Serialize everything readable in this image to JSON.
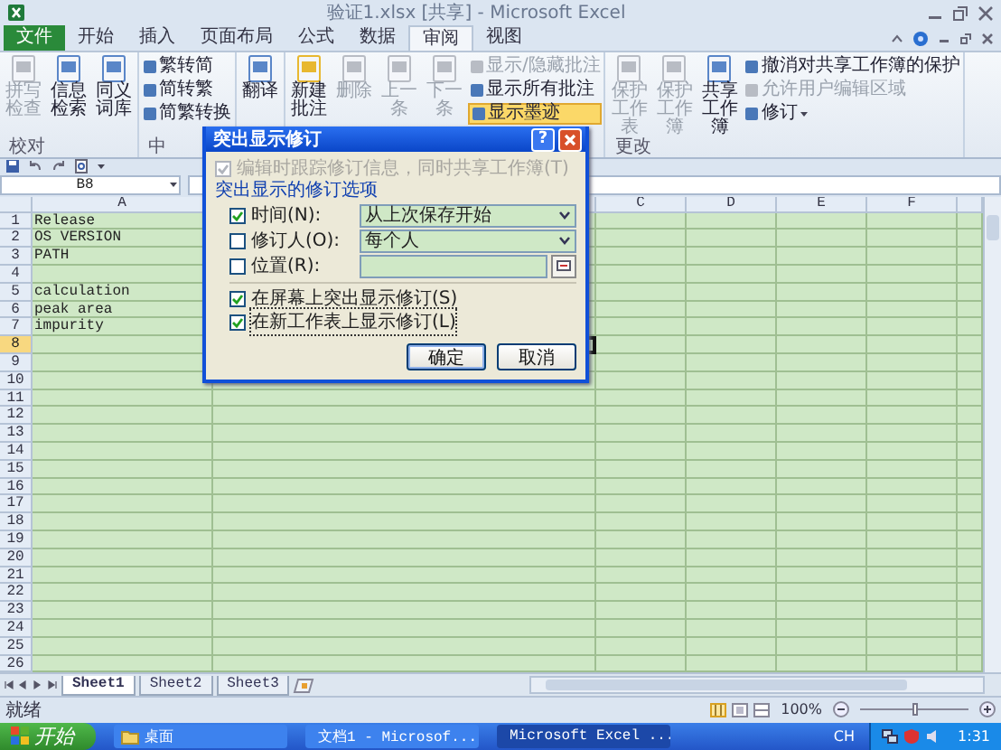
{
  "window": {
    "title": "验证1.xlsx [共享] - Microsoft Excel"
  },
  "tabs": [
    {
      "label": "文件",
      "kind": "file",
      "selected": false
    },
    {
      "label": "开始",
      "kind": "tab",
      "selected": false
    },
    {
      "label": "插入",
      "kind": "tab",
      "selected": false
    },
    {
      "label": "页面布局",
      "kind": "tab",
      "selected": false
    },
    {
      "label": "公式",
      "kind": "tab",
      "selected": false
    },
    {
      "label": "数据",
      "kind": "tab",
      "selected": false
    },
    {
      "label": "审阅",
      "kind": "tab",
      "selected": true
    },
    {
      "label": "视图",
      "kind": "tab",
      "selected": false
    }
  ],
  "ribbon": {
    "groups": [
      {
        "label": "校对",
        "items": [
          {
            "label": "拼写检查",
            "kind": "large",
            "disabled": true
          },
          {
            "label": "信息检索",
            "kind": "large",
            "disabled": false
          },
          {
            "label": "同义词库",
            "kind": "large",
            "disabled": false
          }
        ]
      },
      {
        "label": "中",
        "items": [
          {
            "label": "繁转简",
            "kind": "small",
            "disabled": false,
            "on": false
          },
          {
            "label": "简转繁",
            "kind": "small",
            "disabled": false,
            "on": false
          },
          {
            "label": "简繁转换",
            "kind": "small",
            "disabled": false,
            "on": false
          }
        ]
      },
      {
        "items": [
          {
            "label": "翻译",
            "kind": "large",
            "disabled": false
          }
        ]
      },
      {
        "items": [
          {
            "label": "新建批注",
            "kind": "large",
            "disabled": false
          },
          {
            "label": "删除",
            "kind": "large",
            "disabled": true
          },
          {
            "label": "上一条",
            "kind": "large",
            "disabled": true
          },
          {
            "label": "下一条",
            "kind": "large",
            "disabled": true
          },
          {
            "label": "显示/隐藏批注",
            "kind": "small",
            "disabled": true,
            "on": false
          },
          {
            "label": "显示所有批注",
            "kind": "small",
            "disabled": false,
            "on": false
          },
          {
            "label": "显示墨迹",
            "kind": "small",
            "disabled": false,
            "on": true
          }
        ]
      },
      {
        "label": "更改",
        "items": [
          {
            "label": "保护工作表",
            "kind": "large",
            "disabled": true
          },
          {
            "label": "保护工作簿",
            "kind": "large",
            "disabled": true
          },
          {
            "label": "共享工作簿",
            "kind": "large",
            "disabled": false
          },
          {
            "label": "撤消对共享工作簿的保护",
            "kind": "small",
            "disabled": false,
            "on": false
          },
          {
            "label": "允许用户编辑区域",
            "kind": "small",
            "disabled": true,
            "on": false
          },
          {
            "label": "修订",
            "kind": "small-menu",
            "disabled": false,
            "on": false
          }
        ]
      }
    ]
  },
  "formula_bar": {
    "name_box": "B8"
  },
  "sheet": {
    "columns": [
      {
        "label": "A",
        "kind": "named"
      },
      {
        "kind": "covered"
      },
      {
        "label": "C",
        "kind": "named"
      },
      {
        "label": "D",
        "kind": "named"
      },
      {
        "label": "E",
        "kind": "named"
      },
      {
        "label": "F",
        "kind": "named"
      }
    ],
    "rows": [
      {
        "number": "1",
        "selected": false,
        "cells": [
          "Release"
        ]
      },
      {
        "number": "2",
        "selected": false,
        "cells": [
          "OS VERSION"
        ]
      },
      {
        "number": "3",
        "selected": false,
        "cells": [
          "PATH"
        ]
      },
      {
        "number": "4",
        "selected": false
      },
      {
        "number": "5",
        "selected": false,
        "cells": [
          "calculation"
        ]
      },
      {
        "number": "6",
        "selected": false,
        "cells": [
          "peak area"
        ]
      },
      {
        "number": "7",
        "selected": false,
        "cells": [
          "impurity"
        ]
      },
      {
        "number": "8",
        "selected": true
      },
      {
        "number": "9",
        "selected": false
      },
      {
        "number": "10",
        "selected": false
      },
      {
        "number": "11",
        "selected": false
      },
      {
        "number": "12",
        "selected": false
      },
      {
        "number": "13",
        "selected": false
      },
      {
        "number": "14",
        "selected": false
      },
      {
        "number": "15",
        "selected": false
      },
      {
        "number": "16",
        "selected": false
      },
      {
        "number": "17",
        "selected": false
      },
      {
        "number": "18",
        "selected": false
      },
      {
        "number": "19",
        "selected": false
      },
      {
        "number": "20",
        "selected": false
      },
      {
        "number": "21",
        "selected": false
      },
      {
        "number": "22",
        "selected": false
      },
      {
        "number": "23",
        "selected": false
      },
      {
        "number": "24",
        "selected": false
      },
      {
        "number": "25",
        "selected": false
      },
      {
        "number": "26",
        "selected": false
      }
    ],
    "sheet_tabs": [
      {
        "label": "Sheet1",
        "selected": true
      },
      {
        "label": "Sheet2",
        "selected": false
      },
      {
        "label": "Sheet3",
        "selected": false
      }
    ]
  },
  "status_bar": {
    "text": "就绪",
    "zoom": "100%",
    "level": 0.5
  },
  "dialog": {
    "title": "突出显示修订",
    "help": "?",
    "track_option": {
      "label": "编辑时跟踪修订信息，同时共享工作簿(T)",
      "checked": true,
      "disabled": true
    },
    "group_label": "突出显示的修订选项",
    "filters": [
      {
        "label": "时间(N):",
        "checked": true,
        "kind": "dropdown",
        "value": "从上次保存开始"
      },
      {
        "label": "修订人(O):",
        "checked": false,
        "kind": "dropdown",
        "value": "每个人"
      },
      {
        "label": "位置(R):",
        "checked": false,
        "kind": "range"
      }
    ],
    "options": [
      {
        "label": "在屏幕上突出显示修订(S)",
        "checked": true,
        "focused": false
      },
      {
        "label": "在新工作表上显示修订(L)",
        "checked": true,
        "focused": true
      }
    ],
    "buttons": [
      {
        "label": "确定",
        "default": true
      },
      {
        "label": "取消",
        "default": false
      }
    ]
  },
  "taskbar": {
    "start": "开始",
    "tasks": [
      {
        "label": "桌面",
        "kind": "folder",
        "selected": false
      },
      {
        "label": "文档1 - Microsof...",
        "kind": "word",
        "selected": false
      },
      {
        "label": "Microsoft Excel ...",
        "kind": "excel",
        "selected": true
      }
    ],
    "language": "CH",
    "clock": "1:31"
  }
}
